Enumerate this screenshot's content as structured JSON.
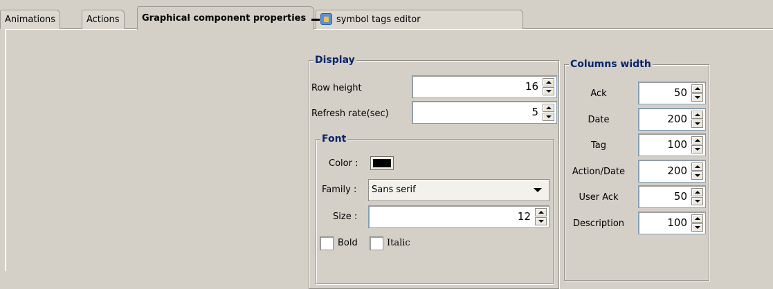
{
  "tabs": [
    {
      "label": "Animations"
    },
    {
      "label": "Actions"
    },
    {
      "label": "Graphical component properties"
    },
    {
      "label": "symbol tags editor"
    }
  ],
  "display": {
    "title": "Display",
    "row_height": {
      "label": "Row height",
      "value": "16"
    },
    "refresh_rate": {
      "label": "Refresh rate(sec)",
      "value": "5"
    }
  },
  "font": {
    "title": "Font",
    "color": {
      "label": "Color :",
      "value": "#000000"
    },
    "family": {
      "label": "Family :",
      "value": "Sans serif"
    },
    "size": {
      "label": "Size :",
      "value": "12"
    },
    "bold": {
      "label": "Bold",
      "checked": false
    },
    "italic": {
      "label": "Italic",
      "checked": false
    }
  },
  "columns": {
    "title": "Columns width",
    "items": [
      {
        "label": "Ack",
        "value": "50"
      },
      {
        "label": "Date",
        "value": "200"
      },
      {
        "label": "Tag",
        "value": "100"
      },
      {
        "label": "Action/Date",
        "value": "200"
      },
      {
        "label": "User Ack",
        "value": "50"
      },
      {
        "label": "Description",
        "value": "100"
      }
    ]
  }
}
